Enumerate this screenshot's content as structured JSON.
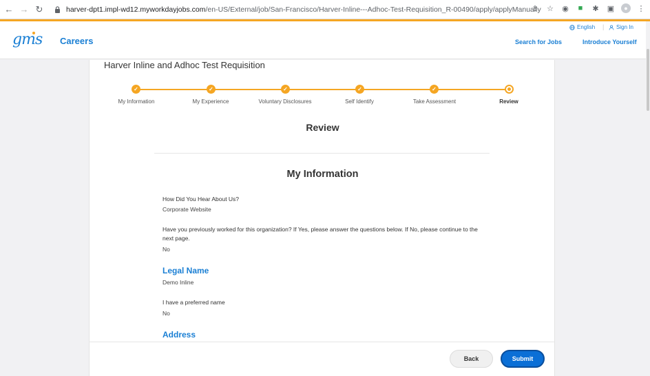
{
  "browser": {
    "url_host": "harver-dpt1.impl-wd12.myworkdayjobs.com",
    "url_path": "/en-US/External/job/San-Francisco/Harver-Inline---Adhoc-Test-Requisition_R-00490/apply/applyManually"
  },
  "header": {
    "logo": "gms",
    "careers": "Careers",
    "language": "English",
    "sign_in": "Sign In",
    "search_jobs": "Search for Jobs",
    "introduce": "Introduce Yourself"
  },
  "job_title": "Harver Inline and Adhoc Test Requisition",
  "steps": [
    {
      "label": "My Information",
      "status": "complete"
    },
    {
      "label": "My Experience",
      "status": "complete"
    },
    {
      "label": "Voluntary Disclosures",
      "status": "complete"
    },
    {
      "label": "Self Identify",
      "status": "complete"
    },
    {
      "label": "Take Assessment",
      "status": "complete"
    },
    {
      "label": "Review",
      "status": "current"
    }
  ],
  "review_title": "Review",
  "section_title": "My Information",
  "fields": {
    "q1": "How Did You Hear About Us?",
    "a1": "Corporate Website",
    "q2": "Have you previously worked for this organization? If Yes, please answer the questions below. If No, please continue to the next page.",
    "a2": "No",
    "legal_name_heading": "Legal Name",
    "legal_name": "Demo Inline",
    "q3": "I have a preferred name",
    "a3": "No",
    "address_heading": "Address"
  },
  "footer": {
    "back": "Back",
    "submit": "Submit"
  },
  "colors": {
    "accent": "#f5a623",
    "brand": "#1a7fd4",
    "submit": "#0b6fd6"
  }
}
